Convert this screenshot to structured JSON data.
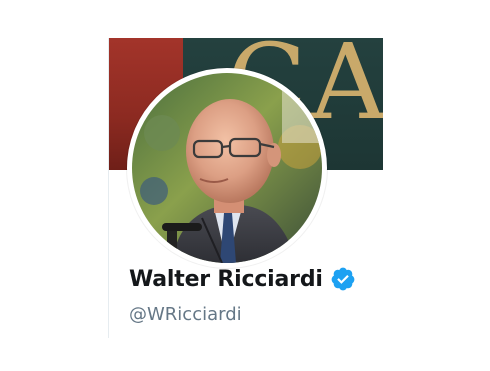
{
  "profile": {
    "display_name": "Walter Ricciardi",
    "handle": "@WRicciardi",
    "verified": true,
    "verified_icon": "verified-badge-icon"
  },
  "banner": {
    "letters": "CA"
  },
  "colors": {
    "verified_blue": "#1da1f2",
    "name_text": "#14171a",
    "handle_text": "#657786",
    "banner_red": "#a3342a",
    "banner_teal": "#24413f",
    "banner_gold": "#c9a96a"
  }
}
